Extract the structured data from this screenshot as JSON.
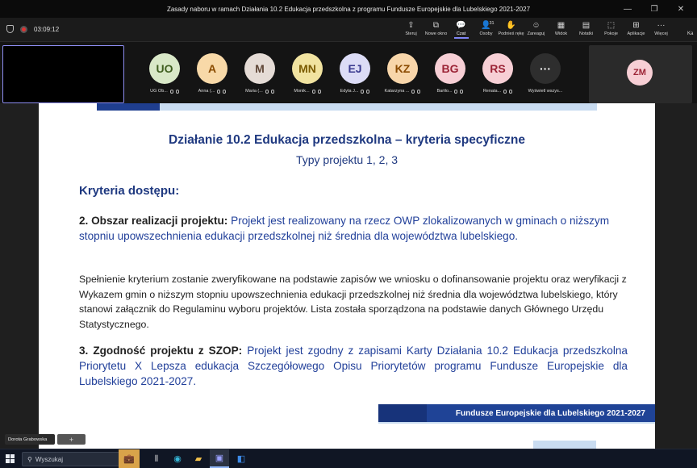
{
  "window": {
    "title": "Zasady naboru w ramach Działania 10.2 Edukacja przedszkolna z programu Fundusze Europejskie dla Lubelskiego 2021-2027",
    "controls": [
      "—",
      "❐",
      "✕"
    ]
  },
  "meeting": {
    "timer": "03:09:12",
    "toolbar": [
      {
        "icon": "share-icon",
        "glyph": "⇪",
        "label": "Steruj"
      },
      {
        "icon": "new-window-icon",
        "glyph": "⧉",
        "label": "Nowe okno"
      },
      {
        "icon": "chat-icon",
        "glyph": "💬",
        "label": "Czat"
      },
      {
        "icon": "people-icon",
        "glyph": "👤",
        "label": "Osoby",
        "count": "31"
      },
      {
        "icon": "raise-hand-icon",
        "glyph": "✋",
        "label": "Podnieś rękę"
      },
      {
        "icon": "react-icon",
        "glyph": "☺",
        "label": "Zareaguj"
      },
      {
        "icon": "view-icon",
        "glyph": "▦",
        "label": "Widok"
      },
      {
        "icon": "notes-icon",
        "glyph": "▤",
        "label": "Notatki"
      },
      {
        "icon": "rooms-icon",
        "glyph": "⬚",
        "label": "Pokoje"
      },
      {
        "icon": "apps-icon",
        "glyph": "⊞",
        "label": "Aplikacje"
      },
      {
        "icon": "more-icon",
        "glyph": "···",
        "label": "Więcej"
      }
    ],
    "edge_label": "Ka"
  },
  "participants": [
    {
      "initials": "UO",
      "name": "UG Ob...",
      "bg": "#d9e8c8",
      "fg": "#3f5e20"
    },
    {
      "initials": "A",
      "name": "Anna (...",
      "bg": "#f8d9a8",
      "fg": "#8a4b00"
    },
    {
      "initials": "M",
      "name": "Maria (...",
      "bg": "#e5dcd6",
      "fg": "#5e4536"
    },
    {
      "initials": "MN",
      "name": "Monik...",
      "bg": "#f1e3a0",
      "fg": "#7a5a00"
    },
    {
      "initials": "EJ",
      "name": "Edyta J...",
      "bg": "#dcdcf6",
      "fg": "#3a3a8f"
    },
    {
      "initials": "KZ",
      "name": "Katarzyna ...",
      "bg": "#f8d6aa",
      "fg": "#8a4a00"
    },
    {
      "initials": "BG",
      "name": "Bartło...",
      "bg": "#f7cfd5",
      "fg": "#9b2335"
    },
    {
      "initials": "RS",
      "name": "Renata...",
      "bg": "#f7cfd5",
      "fg": "#9b2335"
    },
    {
      "initials": "···",
      "name": "Wyświetl wszys...",
      "bg": "#2e2e2e",
      "fg": "#ffffff"
    }
  ],
  "presenter_tile": {
    "initials": "ZM",
    "bg": "#f7cfd5",
    "fg": "#9b2335"
  },
  "slide": {
    "title": "Działanie 10.2 Edukacja przedszkolna – kryteria specyficzne",
    "subtitle": "Typy projektu 1, 2, 3",
    "section": "Kryteria dostępu:",
    "c2_heading": "2. Obszar realizacji projektu:",
    "c2_text": "Projekt jest realizowany na rzecz OWP zlokalizowanych w gminach o niższym stopniu upowszechnienia edukacji przedszkolnej niż średnia dla województwa lubelskiego.",
    "c2_body": "Spełnienie kryterium zostanie zweryfikowane na podstawie zapisów we wniosku o dofinansowanie projektu oraz weryfikacji z Wykazem gmin o niższym stopniu upowszechnienia edukacji przedszkolnej niż średnia dla województwa lubelskiego, który stanowi załącznik do Regulaminu wyboru projektów. Lista została sporządzona na podstawie danych Głównego Urzędu Statystycznego.",
    "c3_heading": "3. Zgodność projektu z SZOP:",
    "c3_text": "Projekt jest zgodny z zapisami Karty Działania 10.2 Edukacja przedszkolna Priorytetu X Lepsza edukacja Szczegółowego Opisu Priorytetów programu Fundusze Europejskie dla Lubelskiego 2021-2027.",
    "footer": "Fundusze Europejskie dla Lubelskiego 2021-2027"
  },
  "speaker": {
    "name": "Dorota Grabowska",
    "pin": "+"
  },
  "taskbar": {
    "search_placeholder": "Wyszukaj"
  }
}
